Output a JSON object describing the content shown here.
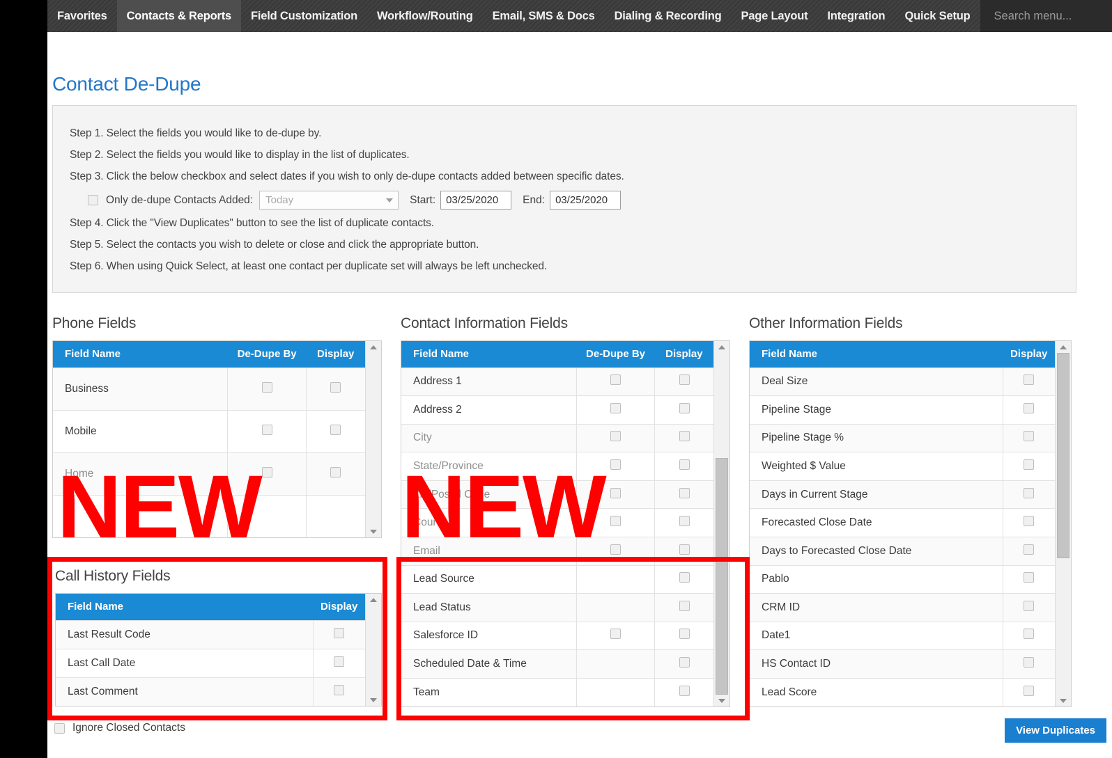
{
  "nav": {
    "items": [
      {
        "label": "Favorites",
        "active": false
      },
      {
        "label": "Contacts & Reports",
        "active": true
      },
      {
        "label": "Field Customization",
        "active": false
      },
      {
        "label": "Workflow/Routing",
        "active": false
      },
      {
        "label": "Email, SMS & Docs",
        "active": false
      },
      {
        "label": "Dialing & Recording",
        "active": false
      },
      {
        "label": "Page Layout",
        "active": false
      },
      {
        "label": "Integration",
        "active": false
      },
      {
        "label": "Quick Setup",
        "active": false
      }
    ],
    "search_placeholder": "Search menu...",
    "search_value": ""
  },
  "page": {
    "title": "Contact De-Dupe"
  },
  "instructions": {
    "steps": [
      "Step 1. Select the fields you would like to de-dupe by.",
      "Step 2. Select the fields you would like to display in the list of duplicates.",
      "Step 3. Click the below checkbox and select dates if you wish to only de-dupe contacts added between specific dates.",
      "Step 4. Click the \"View Duplicates\" button to see the list of duplicate contacts.",
      "Step 5. Select the contacts you wish to delete or close and click the appropriate button.",
      "Step 6. When using Quick Select, at least one contact per duplicate set will always be left unchecked."
    ],
    "date_row": {
      "checkbox_label": "Only de-dupe Contacts Added:",
      "checked": false,
      "period_value": "Today",
      "start_label": "Start:",
      "start_value": "03/25/2020",
      "end_label": "End:",
      "end_value": "03/25/2020"
    }
  },
  "tables": {
    "phone": {
      "heading": "Phone Fields",
      "columns": [
        "Field Name",
        "De-Dupe By",
        "Display"
      ],
      "rows": [
        {
          "name": "Business",
          "dedupe": true,
          "display": true,
          "dim": false
        },
        {
          "name": "Mobile",
          "dedupe": true,
          "display": true,
          "dim": false
        },
        {
          "name": "Home",
          "dedupe": true,
          "display": true,
          "dim": true
        }
      ],
      "overlay_text": "NEW"
    },
    "contact": {
      "heading": "Contact Information Fields",
      "columns": [
        "Field Name",
        "De-Dupe By",
        "Display"
      ],
      "rows": [
        {
          "name": "Address 1",
          "dedupe": true,
          "display": true,
          "dim": false
        },
        {
          "name": "Address 2",
          "dedupe": true,
          "display": true,
          "dim": false
        },
        {
          "name": "City",
          "dedupe": true,
          "display": true,
          "dim": true
        },
        {
          "name": "State/Province",
          "dedupe": true,
          "display": true,
          "dim": true
        },
        {
          "name": "Zip/Postal Code",
          "dedupe": true,
          "display": true,
          "dim": true
        },
        {
          "name": "Country",
          "dedupe": true,
          "display": true,
          "dim": true
        },
        {
          "name": "Email",
          "dedupe": true,
          "display": true,
          "dim": true
        },
        {
          "name": "Lead Source",
          "dedupe": false,
          "display": true,
          "dim": false
        },
        {
          "name": "Lead Status",
          "dedupe": false,
          "display": true,
          "dim": false
        },
        {
          "name": "Salesforce ID",
          "dedupe": true,
          "display": true,
          "dim": false
        },
        {
          "name": "Scheduled Date & Time",
          "dedupe": false,
          "display": true,
          "dim": false
        },
        {
          "name": "Team",
          "dedupe": false,
          "display": true,
          "dim": false
        }
      ],
      "overlay_text": "NEW"
    },
    "other": {
      "heading": "Other Information Fields",
      "columns": [
        "Field Name",
        "Display"
      ],
      "rows": [
        {
          "name": "Deal Size",
          "display": true
        },
        {
          "name": "Pipeline Stage",
          "display": true
        },
        {
          "name": "Pipeline Stage %",
          "display": true
        },
        {
          "name": "Weighted $ Value",
          "display": true
        },
        {
          "name": "Days in Current Stage",
          "display": true
        },
        {
          "name": "Forecasted Close Date",
          "display": true
        },
        {
          "name": "Days to Forecasted Close Date",
          "display": true
        },
        {
          "name": "Pablo",
          "display": true
        },
        {
          "name": "CRM ID",
          "display": true
        },
        {
          "name": "Date1",
          "display": true
        },
        {
          "name": "HS Contact ID",
          "display": true
        },
        {
          "name": "Lead Score",
          "display": true
        }
      ]
    },
    "call_history": {
      "heading": "Call History Fields",
      "columns": [
        "Field Name",
        "Display"
      ],
      "rows": [
        {
          "name": "Last Result Code",
          "display": true
        },
        {
          "name": "Last Call Date",
          "display": true
        },
        {
          "name": "Last Comment",
          "display": true
        }
      ]
    }
  },
  "footer": {
    "ignore_label": "Ignore Closed Contacts",
    "ignore_checked": false,
    "view_duplicates_label": "View Duplicates"
  },
  "colors": {
    "accent_blue": "#1b8ad4",
    "title_blue": "#2277c9",
    "button_blue": "#1b7fd0",
    "highlight_red": "#ff0000"
  }
}
